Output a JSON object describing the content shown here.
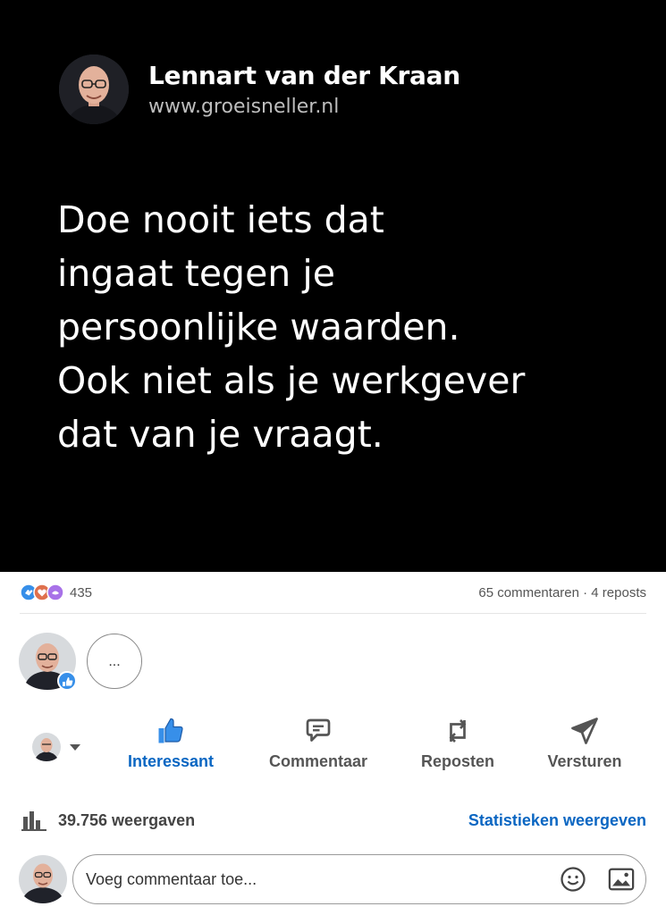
{
  "quote_card": {
    "author_name": "Lennart van der Kraan",
    "website": "www.groeisneller.nl",
    "lines": [
      "Doe nooit iets dat",
      "ingaat tegen je",
      "persoonlijke waarden.",
      "Ook niet als je werkgever",
      "dat van je vraagt."
    ]
  },
  "social": {
    "reaction_icons": [
      "clap-icon",
      "heart-icon",
      "support-icon"
    ],
    "reaction_count": "435",
    "comments_reposts": "65 commentaren · 4 reposts"
  },
  "reactors": {
    "more_label": "..."
  },
  "actions": {
    "like": "Interessant",
    "comment": "Commentaar",
    "repost": "Reposten",
    "send": "Versturen"
  },
  "views": {
    "text": "39.756 weergaven",
    "stats_link": "Statistieken weergeven"
  },
  "comment_box": {
    "placeholder": "Voeg commentaar toe..."
  },
  "colors": {
    "accent": "#0a66c2",
    "quote_bg": "#000000"
  }
}
